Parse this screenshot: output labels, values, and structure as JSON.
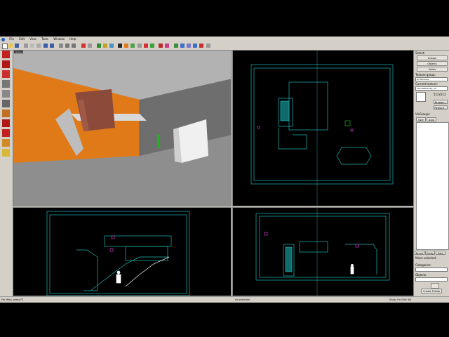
{
  "menu": {
    "items": [
      "File",
      "Edit",
      "View",
      "Tools",
      "Window",
      "Help"
    ]
  },
  "viewports": {
    "camera_label": "camera"
  },
  "panel": {
    "select_label": "Select:",
    "groups_button": "Groups",
    "objects_button": "Objects",
    "solids_button": "Solids",
    "texture_group_label": "Texture group:",
    "texture_group_value": "All Textures",
    "current_texture_label": "Current texture:",
    "current_texture_value": "dev/reflectivity_30",
    "texture_size": "512x512",
    "browse_button": "Browse...",
    "replace_button": "Replace...",
    "visgroups_label": "VisGroups:",
    "tab_user": "User",
    "tab_auto": "Auto",
    "tab_brush": "Brush",
    "tab_entity": "Entity",
    "tab_path": "Path",
    "move_selected_label": "Move selected:",
    "categories_label": "Categories:",
    "objects_label": "Objects:",
    "create_prefab_button": "Create Prefab"
  },
  "status": {
    "help": "For Help, press F1",
    "selection": "no selection.",
    "snap": "Snap: On Grid: 64"
  },
  "colors": {
    "wireframe": "#1fb5b5",
    "orange_wall": "#e07a18",
    "ui_gray": "#d4d0c8"
  }
}
